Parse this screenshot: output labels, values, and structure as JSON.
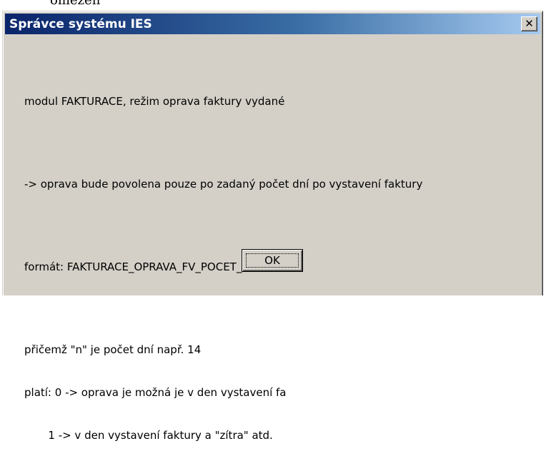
{
  "page": {
    "top_fragment": "omezen"
  },
  "dialog": {
    "title": "Správce systému IES",
    "close_glyph": "✕",
    "lines": [
      "modul FAKTURACE, režim oprava faktury vydané",
      "-> oprava bude povolena pouze po zadaný počet dní po vystavení faktury",
      "formát: FAKTURACE_OPRAVA_FV_POCET_DNI=n",
      "přičemž \"n\" je počet dní např. 14",
      "platí: 0 -> oprava je možná je v den vystavení fa",
      "       1 -> v den vystavení faktury a \"zítra\" atd."
    ],
    "ok_label": "OK"
  },
  "colors": {
    "dialog_bg": "#d4d0c8",
    "title_start": "#0a246a",
    "title_end": "#a6caf0",
    "title_text": "#ffffff"
  }
}
